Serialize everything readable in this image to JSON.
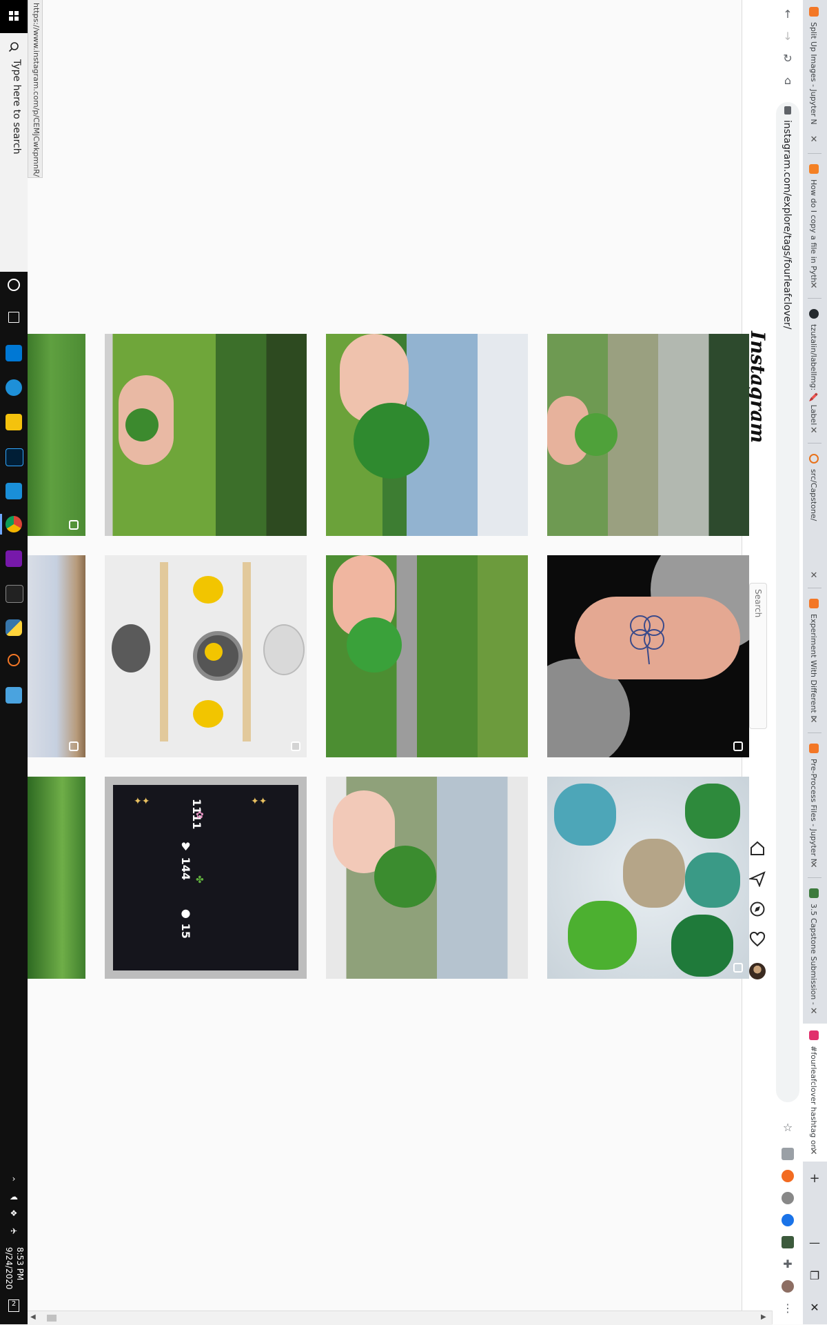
{
  "taskbar": {
    "search_placeholder": "Type here to search",
    "time": "8:53 PM",
    "date": "9/24/2020",
    "notifications": "2"
  },
  "status_url": "https://www.instagram.com/p/CEMjCwkpmnR/",
  "browser": {
    "address": "instagram.com/explore/tags/fourleafclover/",
    "tabs": [
      {
        "title": "Split Up Images - Jupyter N",
        "color": "#f37726"
      },
      {
        "title": "How do I copy a file in Pyth",
        "color": "#f48024"
      },
      {
        "title": "tzutalin/labelImg: 🖍️ Label",
        "color": "#24292e"
      },
      {
        "title": "src/Capstone/",
        "color": "#e8711a"
      },
      {
        "title": "Experiment With Different Im",
        "color": "#f37726"
      },
      {
        "title": "Pre-Process Files - Jupyter N",
        "color": "#f37726"
      },
      {
        "title": "3.5 Capstone Submission - ",
        "color": "#3c7a3c"
      },
      {
        "title": "#fourleafclover hashtag on",
        "color": "#e1306c"
      }
    ]
  },
  "instagram": {
    "logo": "Instagram",
    "search_placeholder": "Search"
  },
  "grid": {
    "post_text": {
      "likes": "144",
      "comments": "15",
      "dots": "1111"
    }
  },
  "colors": {
    "taskbar": "#101010",
    "tabstrip": "#dee1e6",
    "ig_border": "#dbdbdb"
  }
}
